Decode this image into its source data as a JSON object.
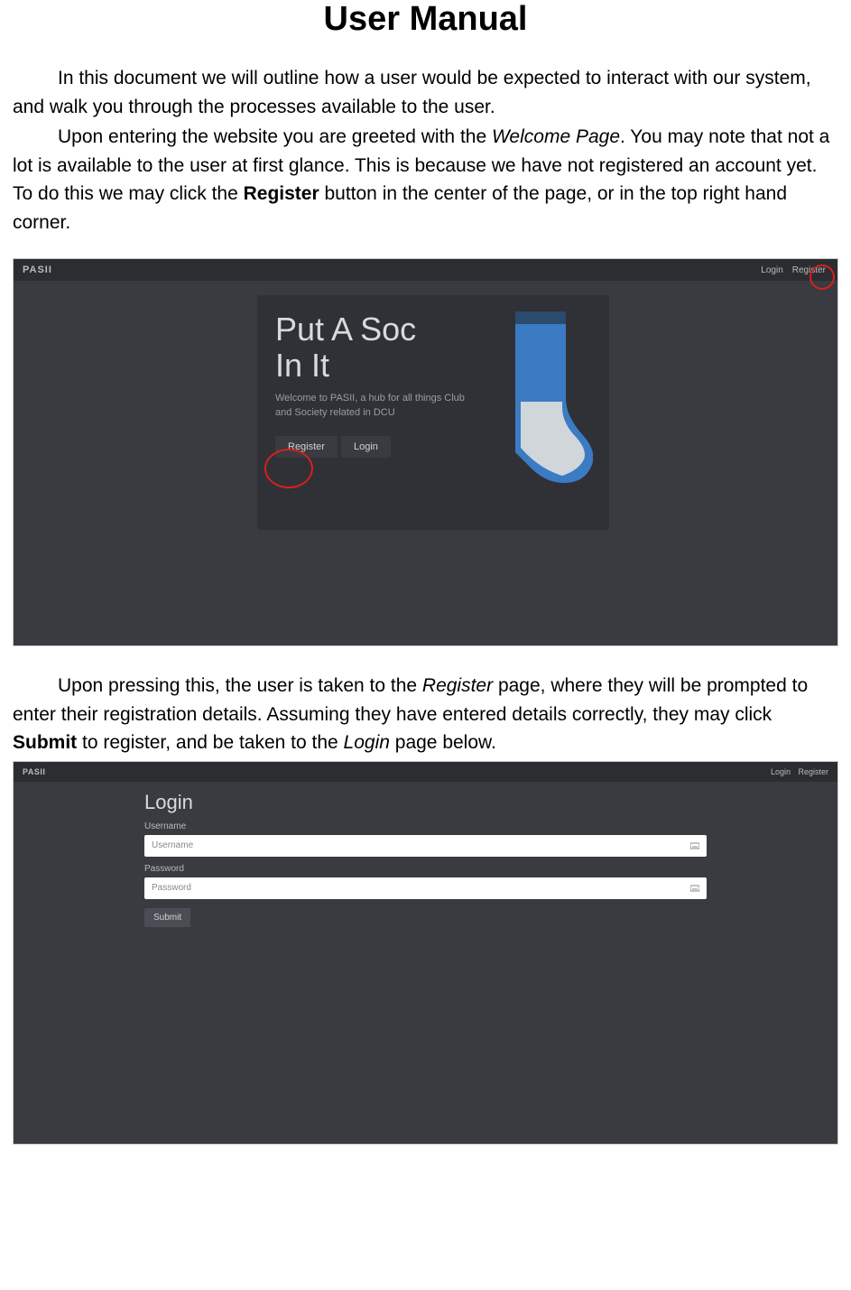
{
  "title": "User Manual",
  "para1a": "In this document we will outline how a user would be expected to interact with our system, and walk you through the processes available to the user.",
  "para1b_pre": "Upon entering the website you are greeted with the ",
  "para1b_em": "Welcome Page",
  "para1b_mid": ". You may note that not a lot is available to the user at first glance. This is because we have not registered an account yet. To do this we may click the ",
  "para1b_bold": "Register",
  "para1b_post": " button in the center of the page, or in the top right hand corner.",
  "shot1": {
    "brand": "PASII",
    "nav_login": "Login",
    "nav_register": "Register",
    "hero_line1": "Put A Soc",
    "hero_line2": "In It",
    "hero_sub": "Welcome to PASII, a hub for all things Club and Society related in DCU",
    "btn_register": "Register",
    "btn_login": "Login"
  },
  "para2_pre": "Upon pressing this, the user is taken to the ",
  "para2_em1": "Register",
  "para2_mid1": " page, where they will be prompted to enter their registration details. Assuming they have entered details correctly, they may click ",
  "para2_bold": "Submit",
  "para2_mid2": " to register, and be taken to the ",
  "para2_em2": "Login",
  "para2_post": " page below.",
  "shot2": {
    "brand": "PASII",
    "nav_login": "Login",
    "nav_register": "Register",
    "form_title": "Login",
    "label_user": "Username",
    "ph_user": "Username",
    "label_pass": "Password",
    "ph_pass": "Password",
    "submit": "Submit"
  }
}
